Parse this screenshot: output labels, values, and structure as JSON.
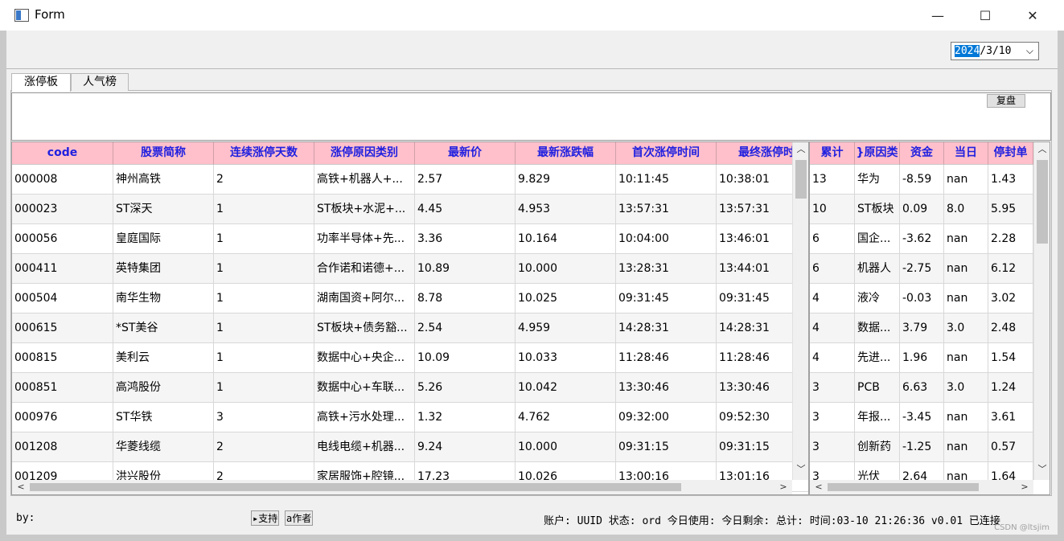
{
  "window": {
    "title": "Form",
    "minimize": "—",
    "maximize": "☐",
    "close": "✕",
    "icon": "app-window-icon"
  },
  "date_picker": {
    "year": "2024",
    "rest": "/3/10",
    "chevron": "⌵"
  },
  "tabs": [
    {
      "label": "涨停板"
    },
    {
      "label": "人气榜"
    }
  ],
  "replay_button": "复盘",
  "main_table": {
    "headers": [
      "code",
      "股票简称",
      "连续涨停天数",
      "涨停原因类别",
      "最新价",
      "最新涨跌幅",
      "首次涨停时间",
      "最终涨停时"
    ],
    "rows": [
      [
        "000008",
        "神州高铁",
        "2",
        "高铁+机器人+...",
        "2.57",
        "9.829",
        "10:11:45",
        "10:38:01"
      ],
      [
        "000023",
        "ST深天",
        "1",
        "ST板块+水泥+...",
        "4.45",
        "4.953",
        "13:57:31",
        "13:57:31"
      ],
      [
        "000056",
        "皇庭国际",
        "1",
        "功率半导体+先...",
        "3.36",
        "10.164",
        "10:04:00",
        "13:46:01"
      ],
      [
        "000411",
        "英特集团",
        "1",
        "合作诺和诺德+...",
        "10.89",
        "10.000",
        "13:28:31",
        "13:44:01"
      ],
      [
        "000504",
        "南华生物",
        "1",
        "湖南国资+阿尔...",
        "8.78",
        "10.025",
        "09:31:45",
        "09:31:45"
      ],
      [
        "000615",
        "*ST美谷",
        "1",
        "ST板块+债务豁...",
        "2.54",
        "4.959",
        "14:28:31",
        "14:28:31"
      ],
      [
        "000815",
        "美利云",
        "1",
        "数据中心+央企...",
        "10.09",
        "10.033",
        "11:28:46",
        "11:28:46"
      ],
      [
        "000851",
        "高鸿股份",
        "1",
        "数据中心+车联...",
        "5.26",
        "10.042",
        "13:30:46",
        "13:30:46"
      ],
      [
        "000976",
        "ST华铁",
        "3",
        "高铁+污水处理...",
        "1.32",
        "4.762",
        "09:32:00",
        "09:52:30"
      ],
      [
        "001208",
        "华菱线缆",
        "2",
        "电线电缆+机器...",
        "9.24",
        "10.000",
        "09:31:15",
        "09:31:15"
      ],
      [
        "001209",
        "洪兴股份",
        "2",
        "家居服饰+腔镜...",
        "17.23",
        "10.026",
        "13:00:16",
        "13:01:16"
      ]
    ]
  },
  "side_table": {
    "headers": [
      "累计",
      "}原因类",
      "资金",
      "当日",
      "停封单"
    ],
    "rows": [
      [
        "13",
        "华为",
        "-8.59",
        "nan",
        "1.43"
      ],
      [
        "10",
        "ST板块",
        "0.09",
        "8.0",
        "5.95"
      ],
      [
        "6",
        "国企...",
        "-3.62",
        "nan",
        "2.28"
      ],
      [
        "6",
        "机器人",
        "-2.75",
        "nan",
        "6.12"
      ],
      [
        "4",
        "液冷",
        "-0.03",
        "nan",
        "3.02"
      ],
      [
        "4",
        "数据...",
        "3.79",
        "3.0",
        "2.48"
      ],
      [
        "4",
        "先进...",
        "1.96",
        "nan",
        "1.54"
      ],
      [
        "3",
        "PCB",
        "6.63",
        "3.0",
        "1.24"
      ],
      [
        "3",
        "年报...",
        "-3.45",
        "nan",
        "3.61"
      ],
      [
        "3",
        "创新药",
        "-1.25",
        "nan",
        "0.57"
      ],
      [
        "3",
        "光伏",
        "2.64",
        "nan",
        "1.64"
      ]
    ]
  },
  "scroll": {
    "up": "︿",
    "down": "﹀",
    "left": "<",
    "right": ">"
  },
  "status": {
    "by": "by:",
    "btn1": "▸支持",
    "btn2": "a作者",
    "info": "账户: UUID 状态: ord 今日使用:  今日剩余:  总计:  时间:03-10 21:26:36 v0.01 已连接"
  },
  "watermark": "CSDN @ltsjim"
}
